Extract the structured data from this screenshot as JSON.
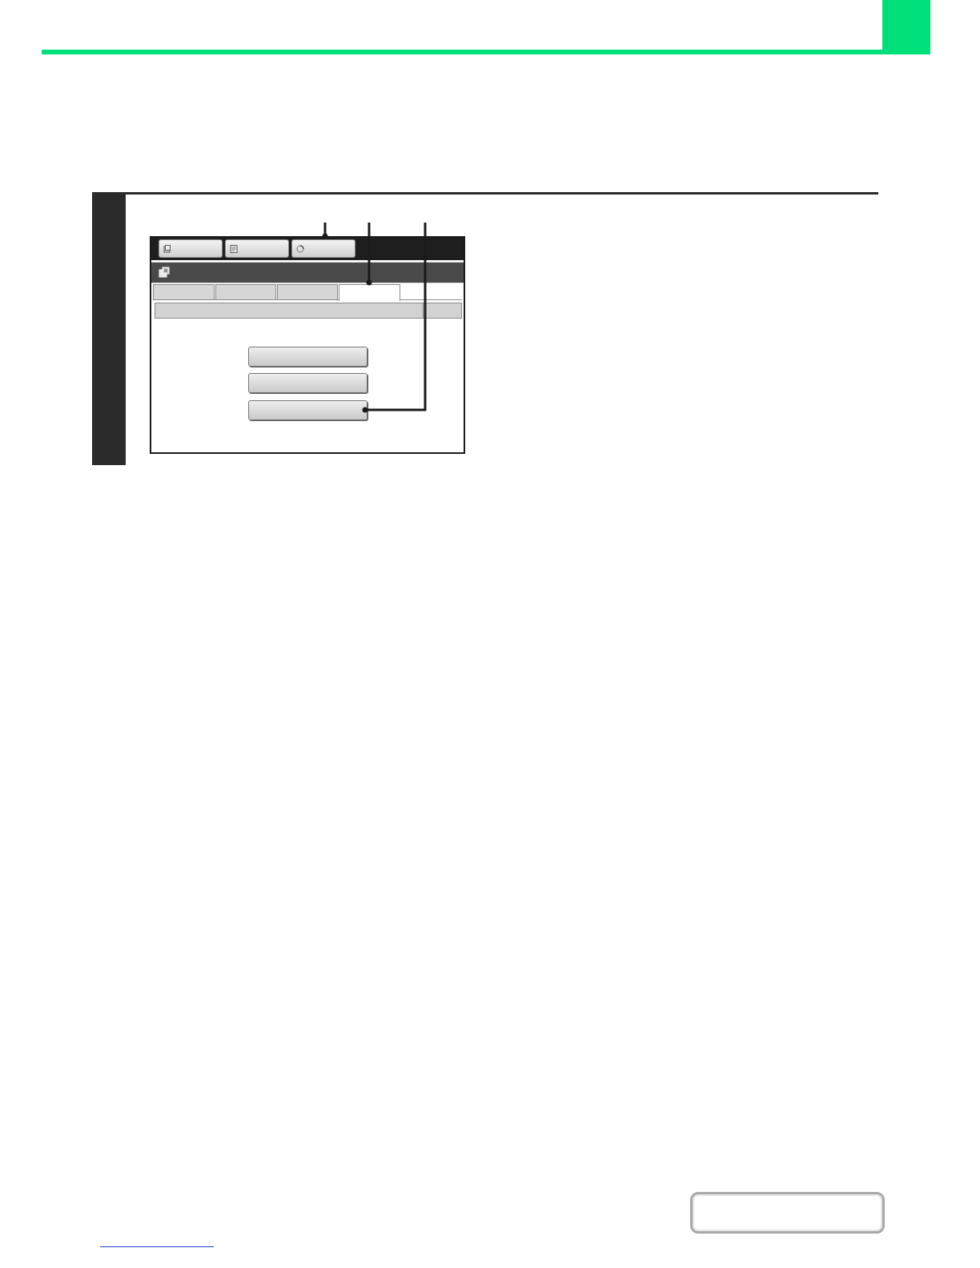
{
  "header": {
    "accent_color": "#00e07a"
  },
  "step": {
    "bar_color": "#2b2b2b"
  },
  "touch_panel": {
    "mode_buttons": [
      {
        "icon": "copy-icon"
      },
      {
        "icon": "document-icon"
      },
      {
        "icon": "status-icon"
      }
    ],
    "title_icon": "settings-icon",
    "tabs": 4,
    "active_tab": 4,
    "menu_buttons": 3,
    "callout_markers": 3
  },
  "footer": {
    "contents_button_icon": "contents-button"
  }
}
